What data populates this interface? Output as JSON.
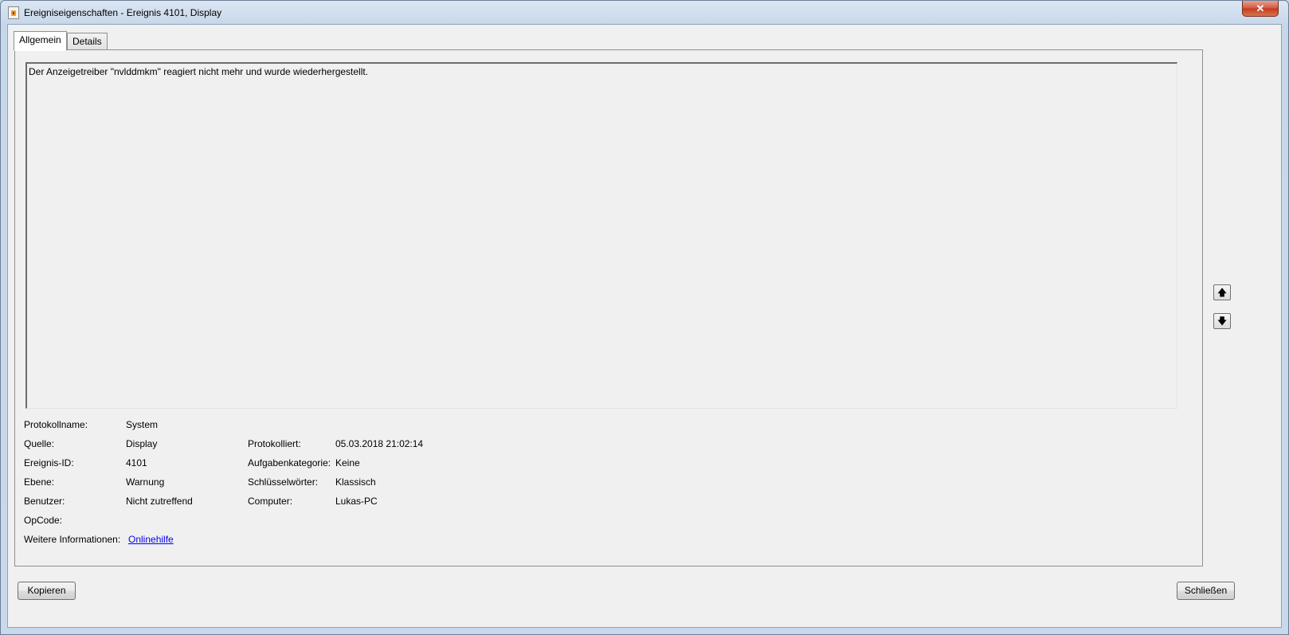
{
  "window": {
    "title": "Ereigniseigenschaften - Ereignis 4101, Display",
    "close_glyph": "✕"
  },
  "tabs": [
    {
      "label": "Allgemein",
      "active": true
    },
    {
      "label": "Details",
      "active": false
    }
  ],
  "description": "Der Anzeigetreiber \"nvlddmkm\" reagiert nicht mehr und wurde wiederhergestellt.",
  "properties": {
    "log_name": {
      "label": "Protokollname:",
      "value": "System"
    },
    "source": {
      "label": "Quelle:",
      "value": "Display"
    },
    "logged": {
      "label": "Protokolliert:",
      "value": "05.03.2018 21:02:14"
    },
    "event_id": {
      "label": "Ereignis-ID:",
      "value": "4101"
    },
    "task_category": {
      "label": "Aufgabenkategorie:",
      "value": "Keine"
    },
    "level": {
      "label": "Ebene:",
      "value": "Warnung"
    },
    "keywords": {
      "label": "Schlüsselwörter:",
      "value": "Klassisch"
    },
    "user": {
      "label": "Benutzer:",
      "value": "Nicht zutreffend"
    },
    "computer": {
      "label": "Computer:",
      "value": "Lukas-PC"
    },
    "opcode": {
      "label": "OpCode:",
      "value": ""
    },
    "more_info": {
      "label": "Weitere Informationen:",
      "link": "Onlinehilfe"
    }
  },
  "nav": {
    "up_glyph": "🡅",
    "down_glyph": "🡇"
  },
  "buttons": {
    "copy": "Kopieren",
    "close": "Schließen"
  }
}
